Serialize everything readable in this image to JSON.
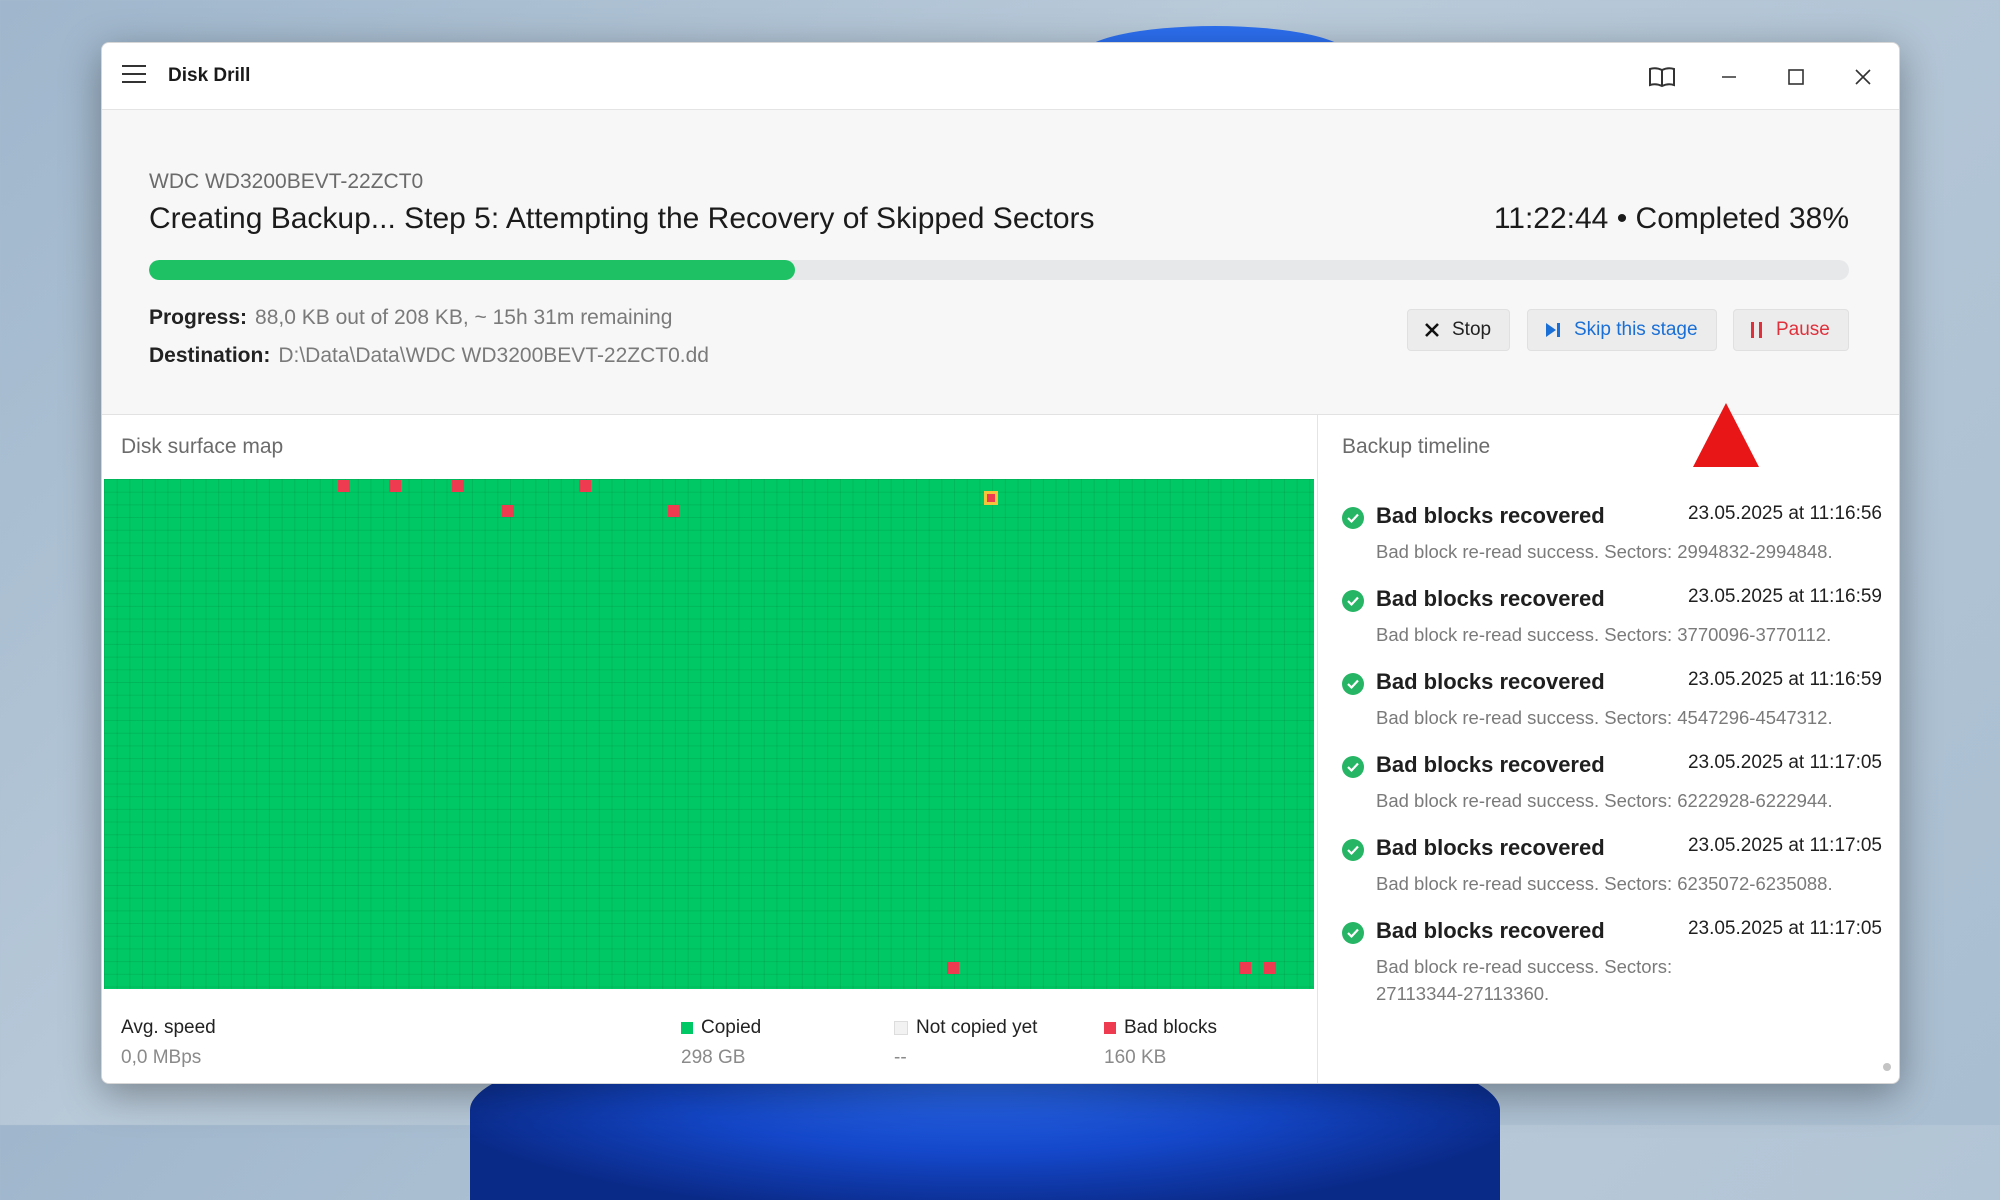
{
  "window": {
    "title": "Disk Drill"
  },
  "header": {
    "disk_name": "WDC WD3200BEVT-22ZCT0",
    "stage_title": "Creating Backup... Step 5: Attempting the Recovery of Skipped Sectors",
    "status": "11:22:44 • Completed 38%",
    "progress_fraction": 0.38,
    "progress_label": "Progress:",
    "progress_value": "88,0 KB out of 208 KB,  ~ 15h 31m remaining",
    "destination_label": "Destination:",
    "destination_value": "D:\\Data\\Data\\WDC WD3200BEVT-22ZCT0.dd"
  },
  "actions": {
    "stop": "Stop",
    "skip": "Skip this stage",
    "pause": "Pause"
  },
  "colors": {
    "copied": "#00c864",
    "not_copied": "#f2f2f2",
    "bad": "#ef3b4f",
    "accent_blue": "#1a6fd6",
    "pause_red": "#e0303b"
  },
  "surface": {
    "title": "Disk surface map",
    "avg_speed_label": "Avg. speed",
    "avg_speed_value": "0,0 MBps",
    "copied_label": "Copied",
    "copied_value": "298 GB",
    "not_copied_label": "Not copied yet",
    "not_copied_value": "--",
    "bad_label": "Bad blocks",
    "bad_value": "160 KB"
  },
  "timeline": {
    "title": "Backup timeline",
    "items": [
      {
        "title": "Bad blocks recovered",
        "time": "23.05.2025 at 11:16:56",
        "desc": "Bad block re-read success. Sectors: 2994832-2994848."
      },
      {
        "title": "Bad blocks recovered",
        "time": "23.05.2025 at 11:16:59",
        "desc": "Bad block re-read success. Sectors: 3770096-3770112."
      },
      {
        "title": "Bad blocks recovered",
        "time": "23.05.2025 at 11:16:59",
        "desc": "Bad block re-read success. Sectors: 4547296-4547312."
      },
      {
        "title": "Bad blocks recovered",
        "time": "23.05.2025 at 11:17:05",
        "desc": "Bad block re-read success. Sectors: 6222928-6222944."
      },
      {
        "title": "Bad blocks recovered",
        "time": "23.05.2025 at 11:17:05",
        "desc": "Bad block re-read success. Sectors: 6235072-6235088."
      },
      {
        "title": "Bad blocks recovered",
        "time": "23.05.2025 at 11:17:05",
        "desc": "Bad block re-read success. Sectors: 27113344-27113360."
      }
    ]
  }
}
